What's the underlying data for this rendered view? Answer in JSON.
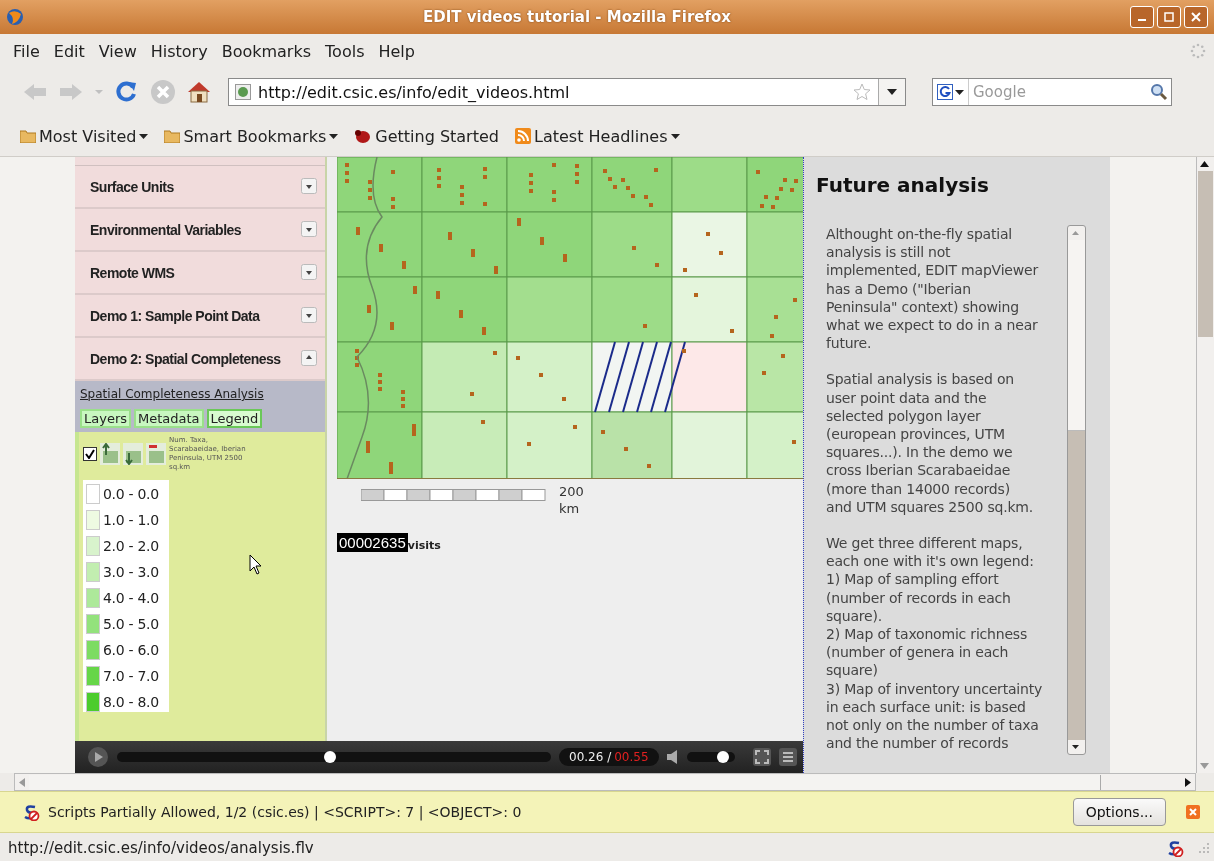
{
  "window": {
    "title": "EDIT videos tutorial - Mozilla Firefox"
  },
  "menu": [
    "File",
    "Edit",
    "View",
    "History",
    "Bookmarks",
    "Tools",
    "Help"
  ],
  "nav_buttons": [
    {
      "kind": "back",
      "disabled": true
    },
    {
      "kind": "forward",
      "disabled": true
    },
    {
      "kind": "history",
      "disabled": true
    },
    {
      "kind": "reload",
      "disabled": false
    },
    {
      "kind": "stop",
      "disabled": true
    },
    {
      "kind": "home",
      "disabled": false
    }
  ],
  "address_bar": {
    "url": "http://edit.csic.es/info/edit_videos.html"
  },
  "search": {
    "placeholder": "Google"
  },
  "bookmarks": [
    {
      "kind": "folder",
      "label": "Most Visited",
      "menu": true
    },
    {
      "kind": "folder",
      "label": "Smart Bookmarks",
      "menu": true
    },
    {
      "kind": "page",
      "label": "Getting Started",
      "menu": false
    },
    {
      "kind": "feed",
      "label": "Latest Headlines",
      "menu": true
    }
  ],
  "video": {
    "sidebar_items": [
      {
        "label": "Surface Units",
        "expanded": false
      },
      {
        "label": "Environmental Variables",
        "expanded": false
      },
      {
        "label": "Remote WMS",
        "expanded": false
      },
      {
        "label": "Demo 1: Sample Point Data",
        "expanded": false
      },
      {
        "label": "Demo 2: Spatial Completeness",
        "expanded": true
      }
    ],
    "analysis_link": "Spatial Completeness Analysis",
    "tabs": [
      {
        "label": "Layers",
        "selected": false
      },
      {
        "label": "Metadata",
        "selected": false
      },
      {
        "label": "Legend",
        "selected": true
      }
    ],
    "layer": {
      "checked": true,
      "label": "Num. Taxa, Scarabaeidae, Iberian Peninsula, UTM 2500 sq.km"
    },
    "legend": [
      {
        "label": "0.0 - 0.0",
        "color": "#ffffff"
      },
      {
        "label": "1.0 - 1.0",
        "color": "#eefbe2"
      },
      {
        "label": "2.0 - 2.0",
        "color": "#d8f3cc"
      },
      {
        "label": "3.0 - 3.0",
        "color": "#c2eeb0"
      },
      {
        "label": "4.0 - 4.0",
        "color": "#ade99a"
      },
      {
        "label": "5.0 - 5.0",
        "color": "#93e27c"
      },
      {
        "label": "6.0 - 6.0",
        "color": "#7ddc62"
      },
      {
        "label": "7.0 - 7.0",
        "color": "#66d648"
      },
      {
        "label": "8.0 - 8.0",
        "color": "#4ccc2c"
      }
    ],
    "scale": {
      "value": "200",
      "unit": "km"
    },
    "counter": {
      "value": "00002635",
      "label": "visits"
    },
    "player": {
      "level": 0.49,
      "elapsed": "00.26 /",
      "duration": "00.55",
      "volume": {
        "level": 0.75
      }
    }
  },
  "panel": {
    "title": "Future analysis",
    "paragraphs": [
      "Althought on-the-fly spatial\nanalysis is still not\nimplemented, EDIT mapViewer\nhas a Demo (\"Iberian\nPeninsula\" context) showing\nwhat we expect to do in a near\nfuture.",
      "Spatial analysis is based on\nuser point data and the\nselected polygon layer\n(european provinces, UTM\nsquares...). In the demo we\ncross Iberian Scarabaeidae\n(more than 14000 records)\nand UTM squares 2500 sq.km.",
      "We get three different maps,\neach one with it's own legend:\n1) Map of sampling effort\n(number of records in each\nsquare).\n2) Map of taxonomic richness\n(number of genera in each\nsquare)\n3) Map of inventory uncertainty\nin each surface unit: is based\nnot only on the number of taxa\nand the number of records"
    ]
  },
  "notification": {
    "text": "Scripts Partially Allowed, 1/2 (csic.es) | <SCRIPT>: 7 | <OBJECT>: 0",
    "button": "Options..."
  },
  "status_bar": {
    "text": "http://edit.csic.es/info/videos/analysis.flv"
  }
}
